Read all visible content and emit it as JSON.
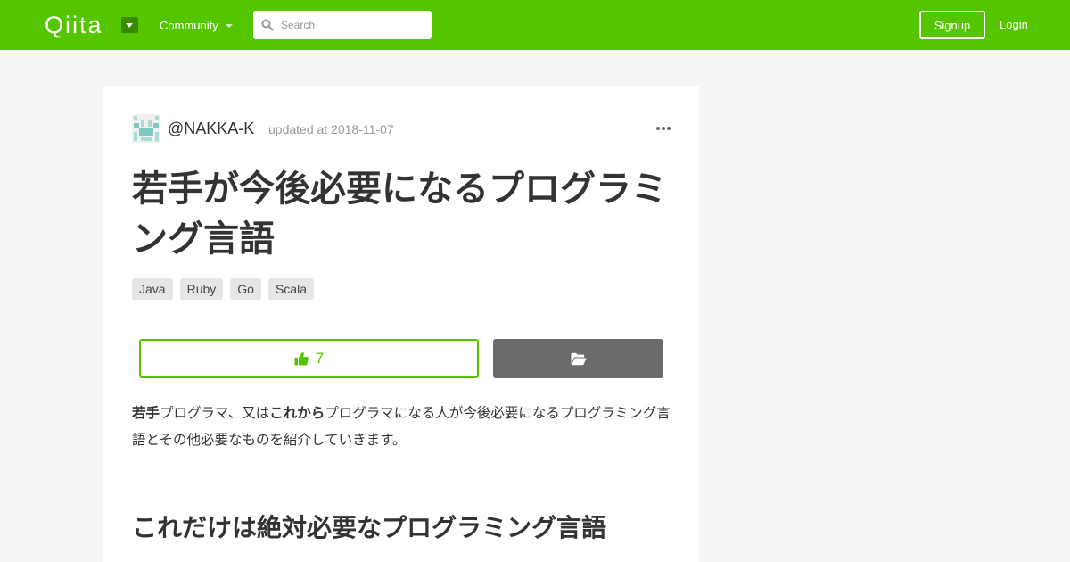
{
  "header": {
    "logo_text": "Qiita",
    "community_label": "Community",
    "search_placeholder": "Search",
    "signup_label": "Signup",
    "login_label": "Login",
    "brand_color": "#55c500"
  },
  "article": {
    "author": "@NAKKA-K",
    "updated": "updated at 2018-11-07",
    "title": "若手が今後必要になるプログラミング言語",
    "tags": [
      "Java",
      "Ruby",
      "Go",
      "Scala"
    ],
    "like_count": "7",
    "body": {
      "part1_bold": "若手",
      "part2": "プログラマ、又は",
      "part3_bold": "これから",
      "part4": "プログラマになる人が今後必要になるプログラミング言語とその他必要なものを紹介していきます。"
    },
    "heading": "これだけは絶対必要なプログラミング言語"
  },
  "icons": {
    "logo_caret": "chevron-down-icon",
    "search": "search-icon",
    "menu": "ellipsis-icon",
    "like": "thumbs-up-icon",
    "stock": "folder-open-icon"
  }
}
